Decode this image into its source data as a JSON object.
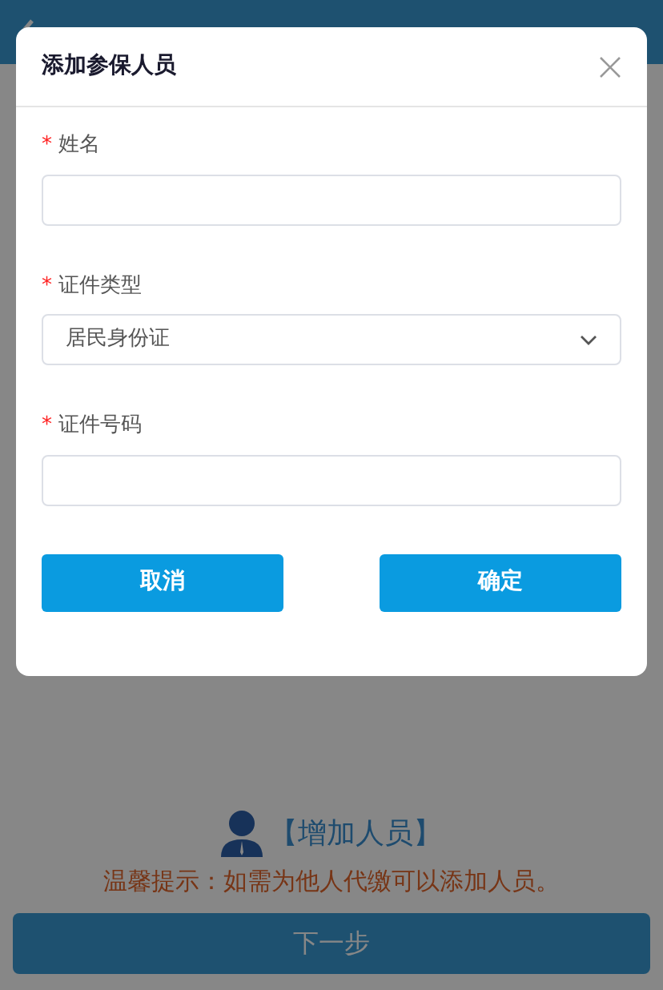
{
  "page": {
    "add_person": "【增加人员】",
    "tip": "温馨提示：如需为他人代缴可以添加人员。",
    "next_button": "下一步"
  },
  "modal": {
    "title": "添加参保人员",
    "fields": [
      {
        "label": "姓名",
        "required_mark": "*",
        "kind": "text"
      },
      {
        "label": "证件类型",
        "required_mark": "*",
        "kind": "select",
        "value": "居民身份证"
      },
      {
        "label": "证件号码",
        "required_mark": "*",
        "kind": "text"
      }
    ],
    "buttons": [
      "取消",
      "确定"
    ]
  }
}
